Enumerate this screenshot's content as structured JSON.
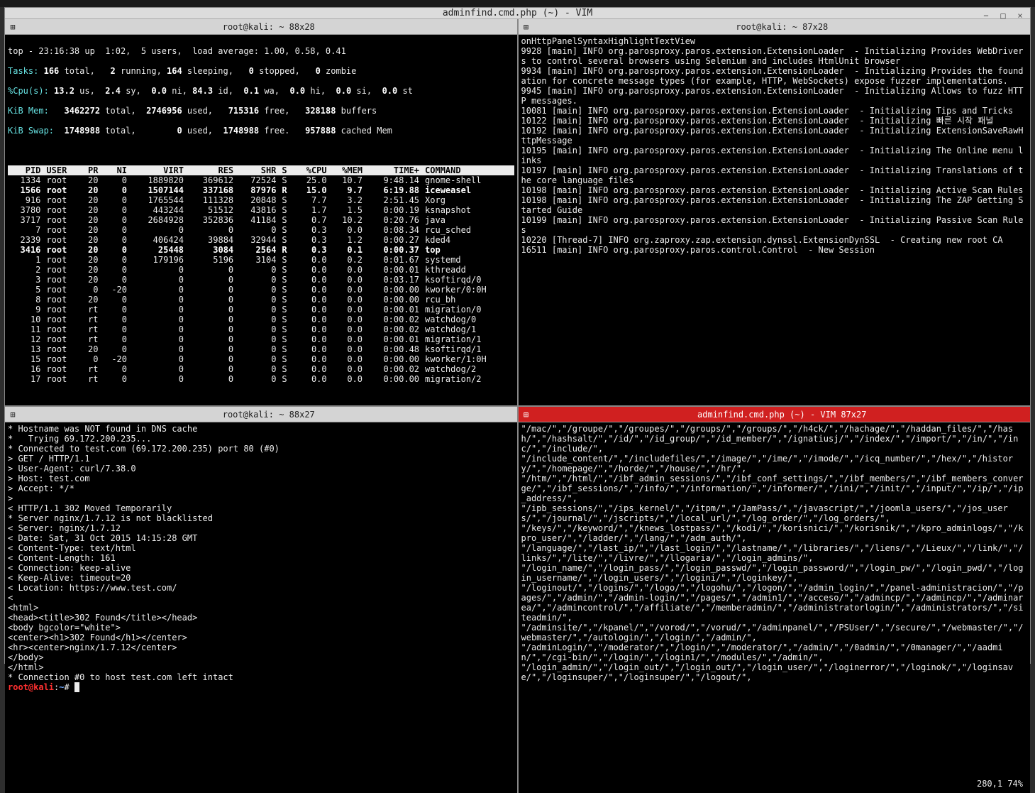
{
  "window": {
    "title": "adminfind.cmd.php (~) - VIM",
    "minimize_icon": "−",
    "maximize_icon": "□",
    "close_icon": "×"
  },
  "panes": {
    "tl": {
      "icon": "⊞",
      "label": "root@kali: ~ 88x28"
    },
    "tr": {
      "icon": "⊞",
      "label": "root@kali: ~ 87x28"
    },
    "bl": {
      "icon": "⊞",
      "label": "root@kali: ~ 88x27"
    },
    "br": {
      "icon": "⊞",
      "label": "adminfind.cmd.php (~) - VIM 87x27"
    }
  },
  "top": {
    "line1": "top - 23:16:38 up  1:02,  5 users,  load average: 1.00, 0.58, 0.41",
    "line2": "Tasks: 166 total,   2 running, 164 sleeping,   0 stopped,   0 zombie",
    "line3": "%Cpu(s): 13.2 us,  2.4 sy,  0.0 ni, 84.3 id,  0.1 wa,  0.0 hi,  0.0 si,  0.0 st",
    "line4": "KiB Mem:   3462272 total,  2746956 used,   715316 free,   328188 buffers",
    "line5": "KiB Swap:  1748988 total,        0 used,  1748988 free.   957888 cached Mem",
    "header": [
      "PID",
      "USER",
      "PR",
      "NI",
      "VIRT",
      "RES",
      "SHR",
      "S",
      "%CPU",
      "%MEM",
      "TIME+",
      "COMMAND"
    ],
    "rows": [
      {
        "pid": "1334",
        "user": "root",
        "pr": "20",
        "ni": "0",
        "virt": "1889820",
        "res": "369612",
        "shr": "72524",
        "s": "S",
        "cpu": "25.0",
        "mem": "10.7",
        "time": "9:48.14",
        "cmd": "gnome-shell",
        "hl": false
      },
      {
        "pid": "1566",
        "user": "root",
        "pr": "20",
        "ni": "0",
        "virt": "1507144",
        "res": "337168",
        "shr": "87976",
        "s": "R",
        "cpu": "15.0",
        "mem": "9.7",
        "time": "6:19.88",
        "cmd": "iceweasel",
        "hl": true
      },
      {
        "pid": "916",
        "user": "root",
        "pr": "20",
        "ni": "0",
        "virt": "1765544",
        "res": "111328",
        "shr": "20848",
        "s": "S",
        "cpu": "7.7",
        "mem": "3.2",
        "time": "2:51.45",
        "cmd": "Xorg",
        "hl": false
      },
      {
        "pid": "3780",
        "user": "root",
        "pr": "20",
        "ni": "0",
        "virt": "443244",
        "res": "51512",
        "shr": "43816",
        "s": "S",
        "cpu": "1.7",
        "mem": "1.5",
        "time": "0:00.19",
        "cmd": "ksnapshot",
        "hl": false
      },
      {
        "pid": "3717",
        "user": "root",
        "pr": "20",
        "ni": "0",
        "virt": "2684928",
        "res": "352836",
        "shr": "41184",
        "s": "S",
        "cpu": "0.7",
        "mem": "10.2",
        "time": "0:20.76",
        "cmd": "java",
        "hl": false
      },
      {
        "pid": "7",
        "user": "root",
        "pr": "20",
        "ni": "0",
        "virt": "0",
        "res": "0",
        "shr": "0",
        "s": "S",
        "cpu": "0.3",
        "mem": "0.0",
        "time": "0:08.34",
        "cmd": "rcu_sched",
        "hl": false
      },
      {
        "pid": "2339",
        "user": "root",
        "pr": "20",
        "ni": "0",
        "virt": "406424",
        "res": "39884",
        "shr": "32944",
        "s": "S",
        "cpu": "0.3",
        "mem": "1.2",
        "time": "0:00.27",
        "cmd": "kded4",
        "hl": false
      },
      {
        "pid": "3416",
        "user": "root",
        "pr": "20",
        "ni": "0",
        "virt": "25448",
        "res": "3084",
        "shr": "2564",
        "s": "R",
        "cpu": "0.3",
        "mem": "0.1",
        "time": "0:00.37",
        "cmd": "top",
        "hl": true
      },
      {
        "pid": "1",
        "user": "root",
        "pr": "20",
        "ni": "0",
        "virt": "179196",
        "res": "5196",
        "shr": "3104",
        "s": "S",
        "cpu": "0.0",
        "mem": "0.2",
        "time": "0:01.67",
        "cmd": "systemd",
        "hl": false
      },
      {
        "pid": "2",
        "user": "root",
        "pr": "20",
        "ni": "0",
        "virt": "0",
        "res": "0",
        "shr": "0",
        "s": "S",
        "cpu": "0.0",
        "mem": "0.0",
        "time": "0:00.01",
        "cmd": "kthreadd",
        "hl": false
      },
      {
        "pid": "3",
        "user": "root",
        "pr": "20",
        "ni": "0",
        "virt": "0",
        "res": "0",
        "shr": "0",
        "s": "S",
        "cpu": "0.0",
        "mem": "0.0",
        "time": "0:03.17",
        "cmd": "ksoftirqd/0",
        "hl": false
      },
      {
        "pid": "5",
        "user": "root",
        "pr": "0",
        "ni": "-20",
        "virt": "0",
        "res": "0",
        "shr": "0",
        "s": "S",
        "cpu": "0.0",
        "mem": "0.0",
        "time": "0:00.00",
        "cmd": "kworker/0:0H",
        "hl": false
      },
      {
        "pid": "8",
        "user": "root",
        "pr": "20",
        "ni": "0",
        "virt": "0",
        "res": "0",
        "shr": "0",
        "s": "S",
        "cpu": "0.0",
        "mem": "0.0",
        "time": "0:00.00",
        "cmd": "rcu_bh",
        "hl": false
      },
      {
        "pid": "9",
        "user": "root",
        "pr": "rt",
        "ni": "0",
        "virt": "0",
        "res": "0",
        "shr": "0",
        "s": "S",
        "cpu": "0.0",
        "mem": "0.0",
        "time": "0:00.01",
        "cmd": "migration/0",
        "hl": false
      },
      {
        "pid": "10",
        "user": "root",
        "pr": "rt",
        "ni": "0",
        "virt": "0",
        "res": "0",
        "shr": "0",
        "s": "S",
        "cpu": "0.0",
        "mem": "0.0",
        "time": "0:00.02",
        "cmd": "watchdog/0",
        "hl": false
      },
      {
        "pid": "11",
        "user": "root",
        "pr": "rt",
        "ni": "0",
        "virt": "0",
        "res": "0",
        "shr": "0",
        "s": "S",
        "cpu": "0.0",
        "mem": "0.0",
        "time": "0:00.02",
        "cmd": "watchdog/1",
        "hl": false
      },
      {
        "pid": "12",
        "user": "root",
        "pr": "rt",
        "ni": "0",
        "virt": "0",
        "res": "0",
        "shr": "0",
        "s": "S",
        "cpu": "0.0",
        "mem": "0.0",
        "time": "0:00.01",
        "cmd": "migration/1",
        "hl": false
      },
      {
        "pid": "13",
        "user": "root",
        "pr": "20",
        "ni": "0",
        "virt": "0",
        "res": "0",
        "shr": "0",
        "s": "S",
        "cpu": "0.0",
        "mem": "0.0",
        "time": "0:00.48",
        "cmd": "ksoftirqd/1",
        "hl": false
      },
      {
        "pid": "15",
        "user": "root",
        "pr": "0",
        "ni": "-20",
        "virt": "0",
        "res": "0",
        "shr": "0",
        "s": "S",
        "cpu": "0.0",
        "mem": "0.0",
        "time": "0:00.00",
        "cmd": "kworker/1:0H",
        "hl": false
      },
      {
        "pid": "16",
        "user": "root",
        "pr": "rt",
        "ni": "0",
        "virt": "0",
        "res": "0",
        "shr": "0",
        "s": "S",
        "cpu": "0.0",
        "mem": "0.0",
        "time": "0:00.02",
        "cmd": "watchdog/2",
        "hl": false
      },
      {
        "pid": "17",
        "user": "root",
        "pr": "rt",
        "ni": "0",
        "virt": "0",
        "res": "0",
        "shr": "0",
        "s": "S",
        "cpu": "0.0",
        "mem": "0.0",
        "time": "0:00.00",
        "cmd": "migration/2",
        "hl": false
      }
    ]
  },
  "curl": {
    "lines": [
      "* Hostname was NOT found in DNS cache",
      "*   Trying 69.172.200.235...",
      "* Connected to test.com (69.172.200.235) port 80 (#0)",
      "> GET / HTTP/1.1",
      "> User-Agent: curl/7.38.0",
      "> Host: test.com",
      "> Accept: */*",
      "> ",
      "< HTTP/1.1 302 Moved Temporarily",
      "* Server nginx/1.7.12 is not blacklisted",
      "< Server: nginx/1.7.12",
      "< Date: Sat, 31 Oct 2015 14:15:28 GMT",
      "< Content-Type: text/html",
      "< Content-Length: 161",
      "< Connection: keep-alive",
      "< Keep-Alive: timeout=20",
      "< Location: https://www.test.com/",
      "< ",
      "<html>",
      "<head><title>302 Found</title></head>",
      "<body bgcolor=\"white\">",
      "<center><h1>302 Found</h1></center>",
      "<hr><center>nginx/1.7.12</center>",
      "</body>",
      "</html>",
      "* Connection #0 to host test.com left intact"
    ],
    "prompt_user": "root@kali",
    "prompt_path": "~",
    "prompt_sep": ":",
    "prompt_hash": "#"
  },
  "log": {
    "lines": [
      "onHttpPanelSyntaxHighlightTextView",
      "9928 [main] INFO org.parosproxy.paros.extension.ExtensionLoader  - Initializing Provides WebDrivers to control several browsers using Selenium and includes HtmlUnit browser",
      "9934 [main] INFO org.parosproxy.paros.extension.ExtensionLoader  - Initializing Provides the foundation for concrete message types (for example, HTTP, WebSockets) expose fuzzer implementations.",
      "9945 [main] INFO org.parosproxy.paros.extension.ExtensionLoader  - Initializing Allows to fuzz HTTP messages.",
      "10081 [main] INFO org.parosproxy.paros.extension.ExtensionLoader  - Initializing Tips and Tricks",
      "10122 [main] INFO org.parosproxy.paros.extension.ExtensionLoader  - Initializing 빠른 시작 패널",
      "10192 [main] INFO org.parosproxy.paros.extension.ExtensionLoader  - Initializing ExtensionSaveRawHttpMessage",
      "10195 [main] INFO org.parosproxy.paros.extension.ExtensionLoader  - Initializing The Online menu links",
      "10197 [main] INFO org.parosproxy.paros.extension.ExtensionLoader  - Initializing Translations of the core language files",
      "10198 [main] INFO org.parosproxy.paros.extension.ExtensionLoader  - Initializing Active Scan Rules",
      "10198 [main] INFO org.parosproxy.paros.extension.ExtensionLoader  - Initializing The ZAP Getting Started Guide",
      "10199 [main] INFO org.parosproxy.paros.extension.ExtensionLoader  - Initializing Passive Scan Rules",
      "10220 [Thread-7] INFO org.zaproxy.zap.extension.dynssl.ExtensionDynSSL  - Creating new root CA",
      "16511 [main] INFO org.parosproxy.paros.control.Control  - New Session"
    ]
  },
  "vim": {
    "content": "\"/mac/\",\"/groupe/\",\"/groupes/\",\"/groups/\",\"/groups/\",\"/h4ck/\",\"/hachage/\",\"/haddan_files/\",\"/hash/\",\"/hashsalt/\",\"/id/\",\"/id_group/\",\"/id_member/\",\"/ignatiusj/\",\"/index/\",\"/import/\",\"/in/\",\"/inc/\",\"/include/\",\n\"/include_content/\",\"/includefiles/\",\"/image/\",\"/ime/\",\"/imode/\",\"/icq_number/\",\"/hex/\",\"/history/\",\"/homepage/\",\"/horde/\",\"/house/\",\"/hr/\",\n\"/htm/\",\"/html/\",\"/ibf_admin_sessions/\",\"/ibf_conf_settings/\",\"/ibf_members/\",\"/ibf_members_converge/\",\"/ibf_sessions/\",\"/info/\",\"/information/\",\"/informer/\",\"/ini/\",\"/init/\",\"/input/\",\"/ip/\",\"/ip_address/\",\n\"/ipb_sessions/\",\"/ips_kernel/\",\"/itpm/\",\"/JamPass/\",\"/javascript/\",\"/joomla_users/\",\"/jos_users/\",\"/journal/\",\"/jscripts/\",\"/local_url/\",\"/log_order/\",\"/log_orders/\",\n\"/keys/\",\"/keyword/\",\"/knews_lostpass/\",\"/kodi/\",\"/korisnici/\",\"/korisnik/\",\"/kpro_adminlogs/\",\"/kpro_user/\",\"/ladder/\",\"/lang/\",\"/adm_auth/\",\n\"/language/\",\"/last_ip/\",\"/last_login/\",\"/lastname/\",\"/libraries/\",\"/liens/\",\"/Lieux/\",\"/link/\",\"/links/\",\"/lite/\",\"/livre/\",\"/llogaria/\",\"/login_admins/\",\n\"/login_name/\",\"/login_pass/\",\"/login_passwd/\",\"/login_password/\",\"/login_pw/\",\"/login_pwd/\",\"/login_username/\",\"/login_users/\",\"/logini/\",\"/loginkey/\",\n\"/loginout/\",\"/logins/\",\"/logo/\",\"/logohu/\",\"/logon/\",\"/admin_login/\",\"/panel-administracion/\",\"/pages/\",\"/admin/\",\"/admin-login/\",\"/pages/\",\"/admin1/\",\"/acceso/\",\"/admincp/\",\"/admincp/\",\"/adminarea/\",\"/admincontrol/\",\"/affiliate/\",\"/memberadmin/\",\"/administratorlogin/\",\"/administrators/\",\"/siteadmin/\",\n\"/adminsite/\",\"/kpanel/\",\"/vorod/\",\"/vorud/\",\"/adminpanel/\",\"/PSUser/\",\"/secure/\",\"/webmaster/\",\"/webmaster/\",\"/autologin/\",\"/login/\",\"/admin/\",\n\"/adminLogin/\",\"/moderator/\",\"/login/\",\"/moderator/\",\"/admin/\",\"/0admin/\",\"/0manager/\",\"/aadmin/\",\"/cgi-bin/\",\"/login/\",\"/login1/\",\"/modules/\",\"/admin/\",\n\"/login_admin/\",\"/login_out/\",\"/login_out/\",\"/login_user/\",\"/loginerror/\",\"/loginok/\",\"/loginsave/\",\"/loginsuper/\",\"/loginsuper/\",\"/logout/\",",
    "status": "280,1          74%"
  }
}
